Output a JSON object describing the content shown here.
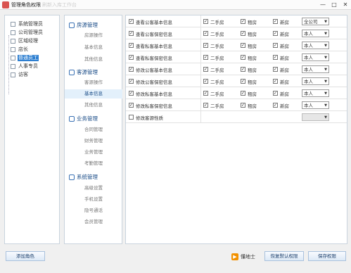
{
  "window": {
    "title": "管理角色权限",
    "ghost_text": "刷新入库工作台"
  },
  "roles": [
    {
      "label": "系统管理员",
      "selected": false
    },
    {
      "label": "公司管理员",
      "selected": false
    },
    {
      "label": "区域经理",
      "selected": false
    },
    {
      "label": "店长",
      "selected": false
    },
    {
      "label": "普通员工",
      "selected": true
    },
    {
      "label": "人事专员",
      "selected": false
    },
    {
      "label": "访客",
      "selected": false
    }
  ],
  "menu": {
    "groups": [
      {
        "label": "房源管理",
        "icon": "house-icon",
        "items": [
          "房源操作",
          "基本信息",
          "其他信息"
        ]
      },
      {
        "label": "客源管理",
        "icon": "people-icon",
        "items": [
          "客源操作",
          "基本信息",
          "其他信息"
        ]
      },
      {
        "label": "业务管理",
        "icon": "globe-icon",
        "items": [
          "合同管理",
          "财务管理",
          "业务管理",
          "考勤管理"
        ]
      },
      {
        "label": "系统管理",
        "icon": "users-icon",
        "items": [
          "高级设置",
          "手机设置",
          "隐号通话",
          "会员管理"
        ]
      }
    ],
    "active_item": "基本信息"
  },
  "permissions": [
    {
      "label": "查看公客基本信息",
      "checked": true,
      "second_hand": "二手房",
      "rent": "租房",
      "new_house": "新房",
      "scope": "全公司"
    },
    {
      "label": "查看公客保密信息",
      "checked": true,
      "second_hand": "二手房",
      "rent": "租房",
      "new_house": "新房",
      "scope": "本人"
    },
    {
      "label": "查看私客基本信息",
      "checked": true,
      "second_hand": "二手房",
      "rent": "租房",
      "new_house": "新房",
      "scope": "本人"
    },
    {
      "label": "查看私客保密信息",
      "checked": true,
      "second_hand": "二手房",
      "rent": "租房",
      "new_house": "新房",
      "scope": "本人"
    },
    {
      "label": "修改公客基本信息",
      "checked": true,
      "second_hand": "二手房",
      "rent": "租房",
      "new_house": "新房",
      "scope": "本人"
    },
    {
      "label": "修改公客保密信息",
      "checked": true,
      "second_hand": "二手房",
      "rent": "租房",
      "new_house": "新房",
      "scope": "本人"
    },
    {
      "label": "修改私客基本信息",
      "checked": true,
      "second_hand": "二手房",
      "rent": "租房",
      "new_house": "新房",
      "scope": "本人"
    },
    {
      "label": "修改私客保密信息",
      "checked": true,
      "second_hand": "二手房",
      "rent": "租房",
      "new_house": "新房",
      "scope": "本人"
    },
    {
      "label": "修改客源性质",
      "checked": false,
      "second_hand": "",
      "rent": "",
      "new_house": "",
      "scope": ""
    }
  ],
  "footer": {
    "add_role": "添加角色",
    "brand": "懂地士",
    "restore": "恢复默认权限",
    "save": "保存权限"
  }
}
